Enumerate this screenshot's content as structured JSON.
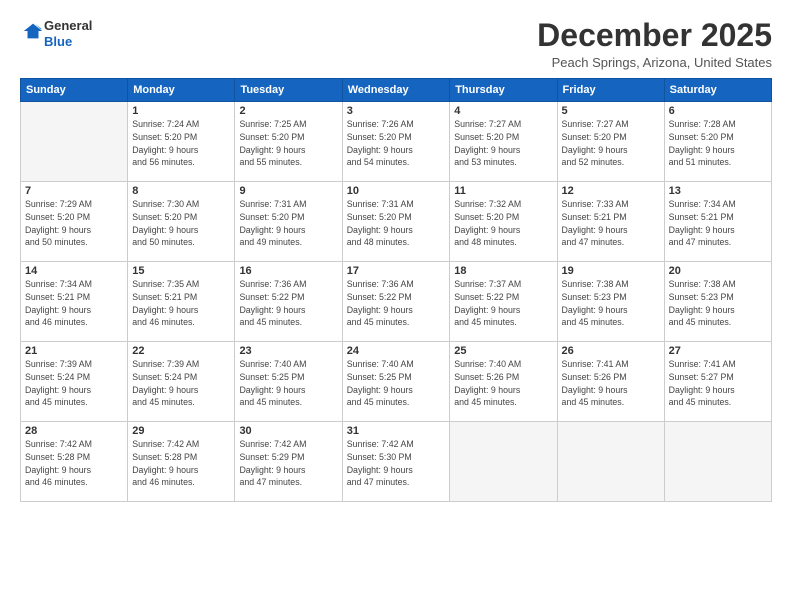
{
  "header": {
    "logo_general": "General",
    "logo_blue": "Blue",
    "month_title": "December 2025",
    "location": "Peach Springs, Arizona, United States"
  },
  "weekdays": [
    "Sunday",
    "Monday",
    "Tuesday",
    "Wednesday",
    "Thursday",
    "Friday",
    "Saturday"
  ],
  "weeks": [
    [
      {
        "day": "",
        "info": ""
      },
      {
        "day": "1",
        "info": "Sunrise: 7:24 AM\nSunset: 5:20 PM\nDaylight: 9 hours\nand 56 minutes."
      },
      {
        "day": "2",
        "info": "Sunrise: 7:25 AM\nSunset: 5:20 PM\nDaylight: 9 hours\nand 55 minutes."
      },
      {
        "day": "3",
        "info": "Sunrise: 7:26 AM\nSunset: 5:20 PM\nDaylight: 9 hours\nand 54 minutes."
      },
      {
        "day": "4",
        "info": "Sunrise: 7:27 AM\nSunset: 5:20 PM\nDaylight: 9 hours\nand 53 minutes."
      },
      {
        "day": "5",
        "info": "Sunrise: 7:27 AM\nSunset: 5:20 PM\nDaylight: 9 hours\nand 52 minutes."
      },
      {
        "day": "6",
        "info": "Sunrise: 7:28 AM\nSunset: 5:20 PM\nDaylight: 9 hours\nand 51 minutes."
      }
    ],
    [
      {
        "day": "7",
        "info": "Sunrise: 7:29 AM\nSunset: 5:20 PM\nDaylight: 9 hours\nand 50 minutes."
      },
      {
        "day": "8",
        "info": "Sunrise: 7:30 AM\nSunset: 5:20 PM\nDaylight: 9 hours\nand 50 minutes."
      },
      {
        "day": "9",
        "info": "Sunrise: 7:31 AM\nSunset: 5:20 PM\nDaylight: 9 hours\nand 49 minutes."
      },
      {
        "day": "10",
        "info": "Sunrise: 7:31 AM\nSunset: 5:20 PM\nDaylight: 9 hours\nand 48 minutes."
      },
      {
        "day": "11",
        "info": "Sunrise: 7:32 AM\nSunset: 5:20 PM\nDaylight: 9 hours\nand 48 minutes."
      },
      {
        "day": "12",
        "info": "Sunrise: 7:33 AM\nSunset: 5:21 PM\nDaylight: 9 hours\nand 47 minutes."
      },
      {
        "day": "13",
        "info": "Sunrise: 7:34 AM\nSunset: 5:21 PM\nDaylight: 9 hours\nand 47 minutes."
      }
    ],
    [
      {
        "day": "14",
        "info": "Sunrise: 7:34 AM\nSunset: 5:21 PM\nDaylight: 9 hours\nand 46 minutes."
      },
      {
        "day": "15",
        "info": "Sunrise: 7:35 AM\nSunset: 5:21 PM\nDaylight: 9 hours\nand 46 minutes."
      },
      {
        "day": "16",
        "info": "Sunrise: 7:36 AM\nSunset: 5:22 PM\nDaylight: 9 hours\nand 45 minutes."
      },
      {
        "day": "17",
        "info": "Sunrise: 7:36 AM\nSunset: 5:22 PM\nDaylight: 9 hours\nand 45 minutes."
      },
      {
        "day": "18",
        "info": "Sunrise: 7:37 AM\nSunset: 5:22 PM\nDaylight: 9 hours\nand 45 minutes."
      },
      {
        "day": "19",
        "info": "Sunrise: 7:38 AM\nSunset: 5:23 PM\nDaylight: 9 hours\nand 45 minutes."
      },
      {
        "day": "20",
        "info": "Sunrise: 7:38 AM\nSunset: 5:23 PM\nDaylight: 9 hours\nand 45 minutes."
      }
    ],
    [
      {
        "day": "21",
        "info": "Sunrise: 7:39 AM\nSunset: 5:24 PM\nDaylight: 9 hours\nand 45 minutes."
      },
      {
        "day": "22",
        "info": "Sunrise: 7:39 AM\nSunset: 5:24 PM\nDaylight: 9 hours\nand 45 minutes."
      },
      {
        "day": "23",
        "info": "Sunrise: 7:40 AM\nSunset: 5:25 PM\nDaylight: 9 hours\nand 45 minutes."
      },
      {
        "day": "24",
        "info": "Sunrise: 7:40 AM\nSunset: 5:25 PM\nDaylight: 9 hours\nand 45 minutes."
      },
      {
        "day": "25",
        "info": "Sunrise: 7:40 AM\nSunset: 5:26 PM\nDaylight: 9 hours\nand 45 minutes."
      },
      {
        "day": "26",
        "info": "Sunrise: 7:41 AM\nSunset: 5:26 PM\nDaylight: 9 hours\nand 45 minutes."
      },
      {
        "day": "27",
        "info": "Sunrise: 7:41 AM\nSunset: 5:27 PM\nDaylight: 9 hours\nand 45 minutes."
      }
    ],
    [
      {
        "day": "28",
        "info": "Sunrise: 7:42 AM\nSunset: 5:28 PM\nDaylight: 9 hours\nand 46 minutes."
      },
      {
        "day": "29",
        "info": "Sunrise: 7:42 AM\nSunset: 5:28 PM\nDaylight: 9 hours\nand 46 minutes."
      },
      {
        "day": "30",
        "info": "Sunrise: 7:42 AM\nSunset: 5:29 PM\nDaylight: 9 hours\nand 47 minutes."
      },
      {
        "day": "31",
        "info": "Sunrise: 7:42 AM\nSunset: 5:30 PM\nDaylight: 9 hours\nand 47 minutes."
      },
      {
        "day": "",
        "info": ""
      },
      {
        "day": "",
        "info": ""
      },
      {
        "day": "",
        "info": ""
      }
    ]
  ]
}
